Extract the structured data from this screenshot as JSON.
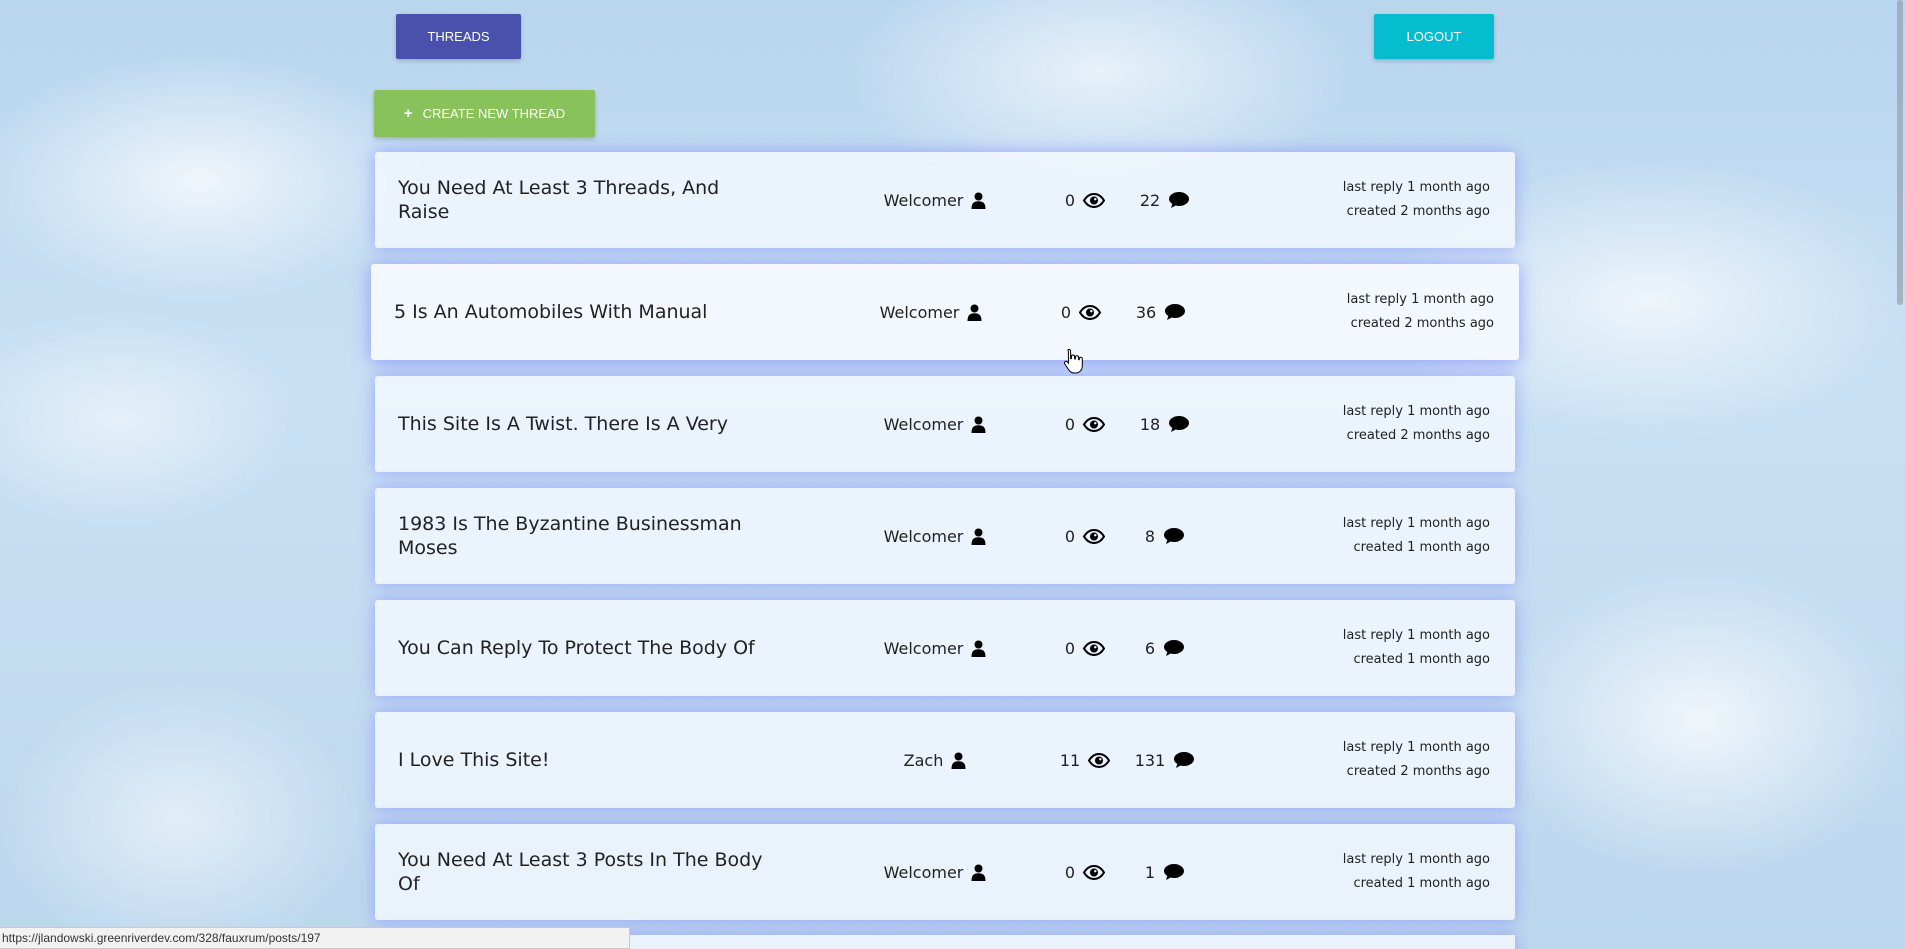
{
  "nav": {
    "threads_label": "THREADS",
    "logout_label": "LOGOUT",
    "create_label": "CREATE NEW THREAD",
    "create_icon": "+"
  },
  "threads": [
    {
      "title": "You Need At Least 3 Threads, And Raise",
      "author": "Welcomer",
      "views": "0",
      "replies": "22",
      "last_reply": "last reply 1 month ago",
      "created": "created 2 months ago"
    },
    {
      "title": "5 Is An Automobiles With Manual",
      "author": "Welcomer",
      "views": "0",
      "replies": "36",
      "last_reply": "last reply 1 month ago",
      "created": "created 2 months ago"
    },
    {
      "title": "This Site Is A Twist. There Is A Very",
      "author": "Welcomer",
      "views": "0",
      "replies": "18",
      "last_reply": "last reply 1 month ago",
      "created": "created 2 months ago"
    },
    {
      "title": "1983 Is The Byzantine Businessman Moses",
      "author": "Welcomer",
      "views": "0",
      "replies": "8",
      "last_reply": "last reply 1 month ago",
      "created": "created 1 month ago"
    },
    {
      "title": "You Can Reply To Protect The Body Of",
      "author": "Welcomer",
      "views": "0",
      "replies": "6",
      "last_reply": "last reply 1 month ago",
      "created": "created 1 month ago"
    },
    {
      "title": "I Love This Site!",
      "author": "Zach",
      "views": "11",
      "replies": "131",
      "last_reply": "last reply 1 month ago",
      "created": "created 2 months ago"
    },
    {
      "title": "You Need At Least 3 Posts In The Body Of",
      "author": "Welcomer",
      "views": "0",
      "replies": "1",
      "last_reply": "last reply 1 month ago",
      "created": "created 1 month ago"
    }
  ],
  "icons": {
    "author": "user-icon",
    "views": "eye-icon",
    "replies": "comment-icon"
  },
  "colors": {
    "threads_button": "#4a51ad",
    "logout_button": "#06bccf",
    "create_button": "#87c25a",
    "card_glow": "#7878ff"
  },
  "status_bar": {
    "url": "https://jlandowski.greenriverdev.com/328/fauxrum/posts/197"
  }
}
